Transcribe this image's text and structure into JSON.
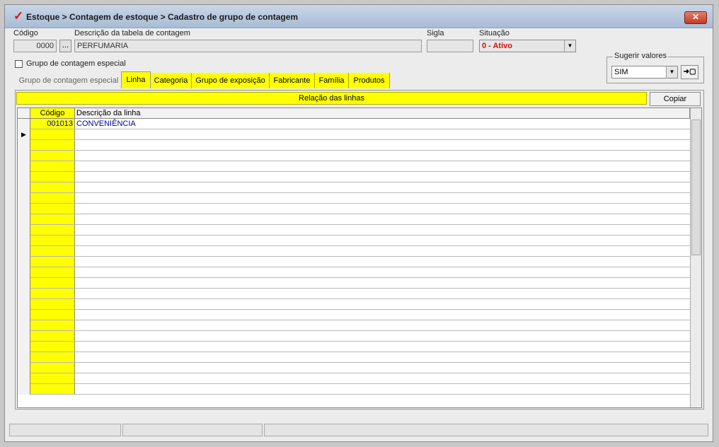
{
  "window": {
    "title": "Estoque > Contagem de estoque > Cadastro de grupo de contagem",
    "close_label": "✕"
  },
  "form": {
    "codigo_label": "Código",
    "codigo_value": "0000",
    "lookup_label": "...",
    "descricao_label": "Descrição da tabela de contagem",
    "descricao_value": "PERFUMARIA",
    "sigla_label": "Sigla",
    "sigla_value": "",
    "situacao_label": "Situação",
    "situacao_value": "0 - Ativo",
    "grupo_especial_label": "Grupo de contagem especial",
    "grupo_especial_checked": false
  },
  "sugerir": {
    "label": "Sugerir valores",
    "value": "SIM",
    "apply_icon": "arrow-to-page-icon"
  },
  "tabs": [
    {
      "label": "Grupo de contagem especial",
      "state": "inactive"
    },
    {
      "label": "Linha",
      "state": "active"
    },
    {
      "label": "Categoria",
      "state": "yellow"
    },
    {
      "label": "Grupo de exposição",
      "state": "yellow"
    },
    {
      "label": "Fabricante",
      "state": "yellow"
    },
    {
      "label": "Família",
      "state": "yellow"
    },
    {
      "label": "Produtos",
      "state": "yellow"
    }
  ],
  "panel": {
    "header": "Relação das linhas",
    "copy_button": "Copiar"
  },
  "grid": {
    "columns": [
      "Código",
      "Descrição da linha"
    ],
    "rows": [
      {
        "code": "001013",
        "desc": "CONVENIÊNCIA"
      }
    ],
    "current_row_marker": "▶",
    "empty_rows": 25
  },
  "colors": {
    "highlight": "#ffff00",
    "situacao_text": "#d01010",
    "grid_text": "#0000a0"
  }
}
